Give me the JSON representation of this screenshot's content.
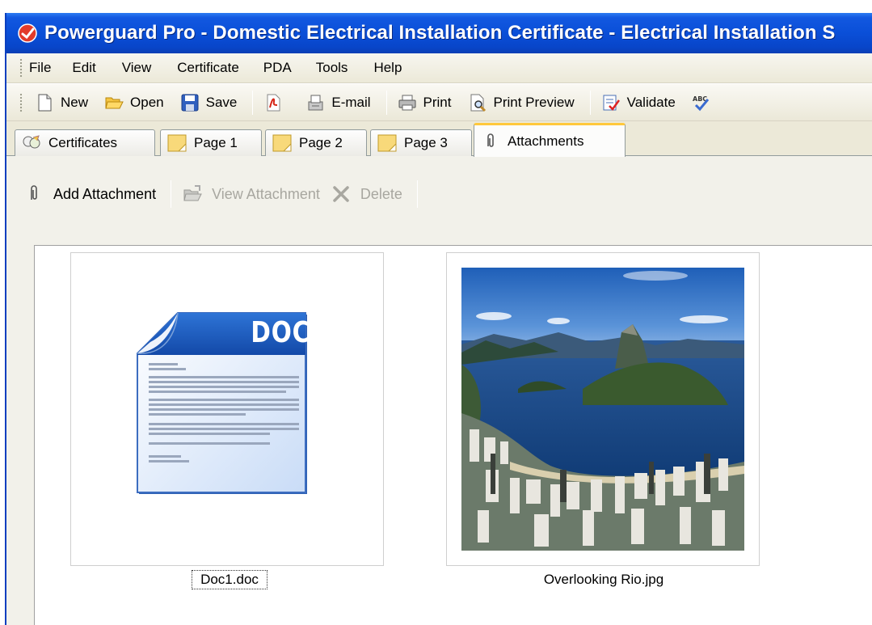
{
  "window": {
    "title": "Powerguard Pro - Domestic Electrical Installation Certificate - Electrical Installation S"
  },
  "menu": [
    {
      "label": "File"
    },
    {
      "label": "Edit"
    },
    {
      "label": "View"
    },
    {
      "label": "Certificate"
    },
    {
      "label": "PDA"
    },
    {
      "label": "Tools"
    },
    {
      "label": "Help"
    }
  ],
  "toolbar": {
    "new_label": "New",
    "open_label": "Open",
    "save_label": "Save",
    "email_label": "E-mail",
    "print_label": "Print",
    "print_preview_label": "Print Preview",
    "validate_label": "Validate"
  },
  "tabs": [
    {
      "label": "Certificates"
    },
    {
      "label": "Page 1"
    },
    {
      "label": "Page 2"
    },
    {
      "label": "Page 3"
    },
    {
      "label": "Attachments",
      "active": true
    }
  ],
  "attachments_toolbar": {
    "add_label": "Add Attachment",
    "view_label": "View Attachment",
    "delete_label": "Delete"
  },
  "attachments": [
    {
      "name": "Doc1.doc",
      "icon": "doc-file-icon",
      "badge": "DOC",
      "selected": true
    },
    {
      "name": "Overlooking Rio.jpg",
      "icon": "photo-thumbnail",
      "selected": false
    }
  ],
  "colors": {
    "titlebar": "#0a4fd8",
    "active_tab_accent": "#ffc83c",
    "chrome": "#ece9d8"
  }
}
